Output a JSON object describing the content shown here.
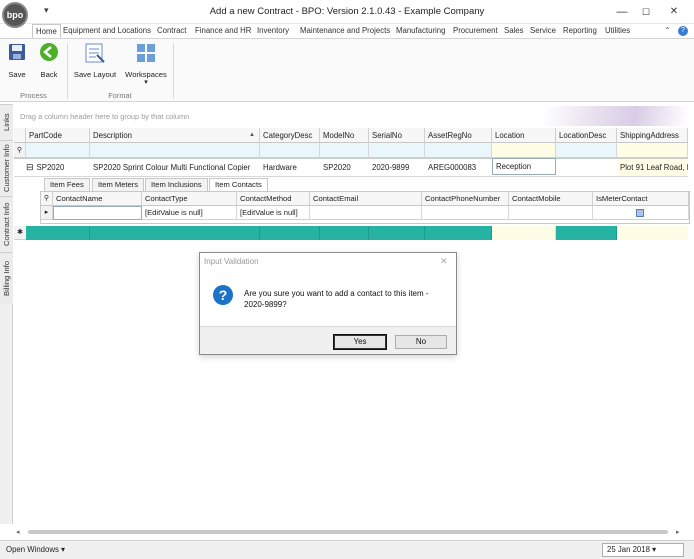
{
  "app": {
    "logo_text": "bpo",
    "title": "Add a new Contract - BPO: Version 2.1.0.43 - Example Company",
    "qat_glyph": "▾"
  },
  "window_controls": {
    "minimize": "—",
    "maximize": "☐",
    "close": "✕"
  },
  "menu": {
    "tabs": [
      "Home",
      "Equipment and Locations",
      "Contract",
      "Finance and HR",
      "Inventory",
      "Maintenance and Projects",
      "Manufacturing",
      "Procurement",
      "Sales",
      "Service",
      "Reporting",
      "Utilities"
    ],
    "active": "Home",
    "collapse_glyph": "⌃",
    "help_glyph": "?"
  },
  "ribbon": {
    "buttons": [
      {
        "label": "Save",
        "icon": "floppy-disk-icon"
      },
      {
        "label": "Back",
        "icon": "back-arrow-icon"
      },
      {
        "label": "Save Layout",
        "icon": "save-layout-icon"
      },
      {
        "label": "Workspaces",
        "icon": "workspaces-icon",
        "dropdown": "▾"
      }
    ],
    "groups": [
      {
        "label": "Process"
      },
      {
        "label": "Format"
      }
    ]
  },
  "side_tabs": [
    "Links",
    "Customer Info",
    "Contract Info",
    "Billing Info"
  ],
  "grid": {
    "group_hint": "Drag a column header here to group by that column",
    "columns": [
      "PartCode",
      "Description",
      "CategoryDesc",
      "ModelNo",
      "SerialNo",
      "AssetRegNo",
      "Location",
      "LocationDesc",
      "ShippingAddress"
    ],
    "sort_glyph": "▲",
    "filter_glyph": "⚲",
    "row": {
      "expander": "⊟",
      "cells": [
        "SP2020",
        "SP2020 Sprint Colour Multi Functional Copier",
        "Hardware",
        "SP2020",
        "2020-9899",
        "AREG000083",
        "Reception",
        "",
        "Plot 91 Leaf Road, Fo"
      ]
    },
    "new_row_glyph": "✱"
  },
  "detail": {
    "tabs": [
      "Item Fees",
      "Item Meters",
      "Item Inclusions",
      "Item Contacts"
    ],
    "active_tab": "Item Contacts",
    "columns": [
      "ContactName",
      "ContactType",
      "ContactMethod",
      "ContactEmail",
      "ContactPhoneNumber",
      "ContactMobile",
      "IsMeterContact"
    ],
    "row_indicator": "▸",
    "row": {
      "ContactName": "",
      "ContactType": "[EditValue is null]",
      "ContactMethod": "[EditValue is null]",
      "ContactEmail": "",
      "ContactPhoneNumber": "",
      "ContactMobile": "",
      "IsMeterContact": ""
    }
  },
  "dialog": {
    "title": "Input Validation",
    "close_glyph": "✕",
    "icon": "?",
    "message": "Are you sure you want to add a contact to this item - 2020-9899?",
    "yes_label": "Yes",
    "no_label": "No"
  },
  "statusbar": {
    "open_windows": "Open Windows ▾",
    "date": "25 Jan 2018 ▾"
  },
  "colors": {
    "teal_row": "#26b3a3",
    "filter_row": "#e9f7fc",
    "highlight_col": "#fffde6",
    "dialog_icon": "#1a73c7"
  }
}
